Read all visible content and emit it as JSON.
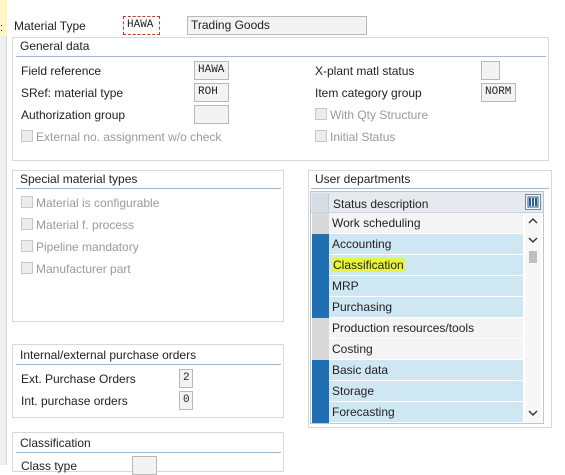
{
  "header": {
    "material_type_label": "Material Type",
    "material_type_value": "HAWA",
    "material_type_desc": "Trading Goods"
  },
  "general_data": {
    "title": "General data",
    "field_reference_label": "Field reference",
    "field_reference_value": "HAWA",
    "sref_label": "SRef: material type",
    "sref_value": "ROH",
    "auth_group_label": "Authorization group",
    "auth_group_value": "",
    "ext_no_label": "External no. assignment w/o check",
    "xplant_label": "X-plant matl status",
    "xplant_value": "",
    "item_cat_label": "Item category group",
    "item_cat_value": "NORM",
    "with_qty_label": "With Qty Structure",
    "initial_status_label": "Initial Status"
  },
  "special_types": {
    "title": "Special material types",
    "items": [
      "Material is configurable",
      "Material f. process",
      "Pipeline mandatory",
      "Manufacturer part"
    ]
  },
  "user_departments": {
    "title": "User departments",
    "column_header": "Status description",
    "rows": [
      {
        "label": "Work scheduling",
        "selected": false
      },
      {
        "label": "Accounting",
        "selected": true
      },
      {
        "label": "Classification",
        "selected": true
      },
      {
        "label": "MRP",
        "selected": true
      },
      {
        "label": "Purchasing",
        "selected": true
      },
      {
        "label": "Production resources/tools",
        "selected": false
      },
      {
        "label": "Costing",
        "selected": false
      },
      {
        "label": "Basic data",
        "selected": true
      },
      {
        "label": "Storage",
        "selected": true
      },
      {
        "label": "Forecasting",
        "selected": true
      }
    ]
  },
  "purchase_orders": {
    "title": "Internal/external purchase orders",
    "ext_label": "Ext. Purchase Orders",
    "ext_value": "2",
    "int_label": "Int. purchase orders",
    "int_value": "0"
  },
  "classification": {
    "title": "Classification",
    "class_type_label": "Class type"
  },
  "colors": {
    "selected_row_bg": "#cfe6f3",
    "selector_blue": "#1f6fb2",
    "highlight": "#e9f53a",
    "group_line": "#9fb8d6"
  }
}
